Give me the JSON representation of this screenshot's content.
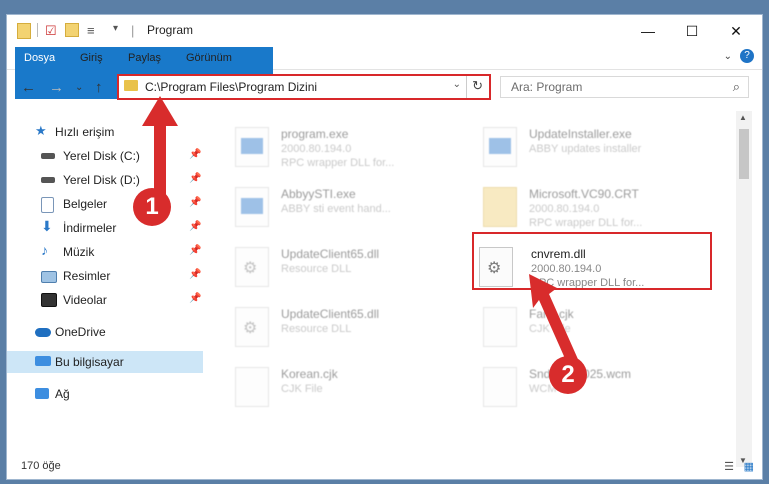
{
  "window": {
    "title": "Program",
    "minimize": "—",
    "maximize": "☐",
    "close": "✕"
  },
  "ribbon": {
    "tabs": [
      "Dosya",
      "Giriş",
      "Paylaş",
      "Görünüm"
    ],
    "expand": "⌄",
    "help": "?"
  },
  "nav": {
    "back": "←",
    "forward": "→",
    "recent": "⌄",
    "up": "↑",
    "address": "C:\\Program Files\\Program Dizini",
    "address_dropdown": "⌄",
    "refresh": "↻",
    "search_placeholder": "Ara: Program",
    "search_icon": "⌕"
  },
  "sidebar": {
    "items": [
      {
        "label": "Hızlı erişim",
        "icon": "star-icon",
        "pinned": false
      },
      {
        "label": "Yerel Disk (C:)",
        "icon": "drive-icon",
        "pinned": true
      },
      {
        "label": "Yerel Disk (D:)",
        "icon": "drive-icon",
        "pinned": true
      },
      {
        "label": "Belgeler",
        "icon": "documents-icon",
        "pinned": true
      },
      {
        "label": "İndirmeler",
        "icon": "downloads-icon",
        "pinned": true
      },
      {
        "label": "Müzik",
        "icon": "music-icon",
        "pinned": true
      },
      {
        "label": "Resimler",
        "icon": "pictures-icon",
        "pinned": true
      },
      {
        "label": "Videolar",
        "icon": "videos-icon",
        "pinned": true
      },
      {
        "label": "OneDrive",
        "icon": "cloud-icon",
        "pinned": false
      },
      {
        "label": "Bu bilgisayar",
        "icon": "computer-icon",
        "pinned": false,
        "selected": true
      },
      {
        "label": "Ağ",
        "icon": "network-icon",
        "pinned": false
      }
    ]
  },
  "files": [
    {
      "name": "program.exe",
      "line2": "2000.80.194.0",
      "line3": "RPC wrapper DLL for...",
      "icon": "exe-icon"
    },
    {
      "name": "UpdateInstaller.exe",
      "line2": "ABBY updates installer",
      "line3": "",
      "icon": "exe-icon"
    },
    {
      "name": "AbbyySTI.exe",
      "line2": "ABBY sti event hand...",
      "line3": "",
      "icon": "exe-icon"
    },
    {
      "name": "Microsoft.VC90.CRT",
      "line2": "2000.80.194.0",
      "line3": "RPC wrapper DLL for...",
      "icon": "folder-icon"
    },
    {
      "name": "UpdateClient65.dll",
      "line2": "Resource DLL",
      "line3": "",
      "icon": "dll-icon"
    },
    {
      "name": "cnvrem.dll",
      "line2": "2000.80.194.0",
      "line3": "RPC wrapper DLL for...",
      "icon": "dll-icon"
    },
    {
      "name": "UpdateClient65.dll",
      "line2": "Resource DLL",
      "line3": "",
      "icon": "dll-icon"
    },
    {
      "name": "Farsi.cjk",
      "line2": "CJK File",
      "line3": "",
      "icon": "file-icon"
    },
    {
      "name": "Korean.cjk",
      "line2": "CJK File",
      "line3": "",
      "icon": "file-icon"
    },
    {
      "name": "SndFile_1025.wcm",
      "line2": "WCM File",
      "line3": "",
      "icon": "file-icon"
    }
  ],
  "status": {
    "count": "170 öğe",
    "details_view": "☰",
    "tiles_view": "▦"
  },
  "annotations": {
    "badge1": "1",
    "badge2": "2"
  },
  "colors": {
    "highlight": "#d8282a",
    "accent": "#1979ca"
  }
}
